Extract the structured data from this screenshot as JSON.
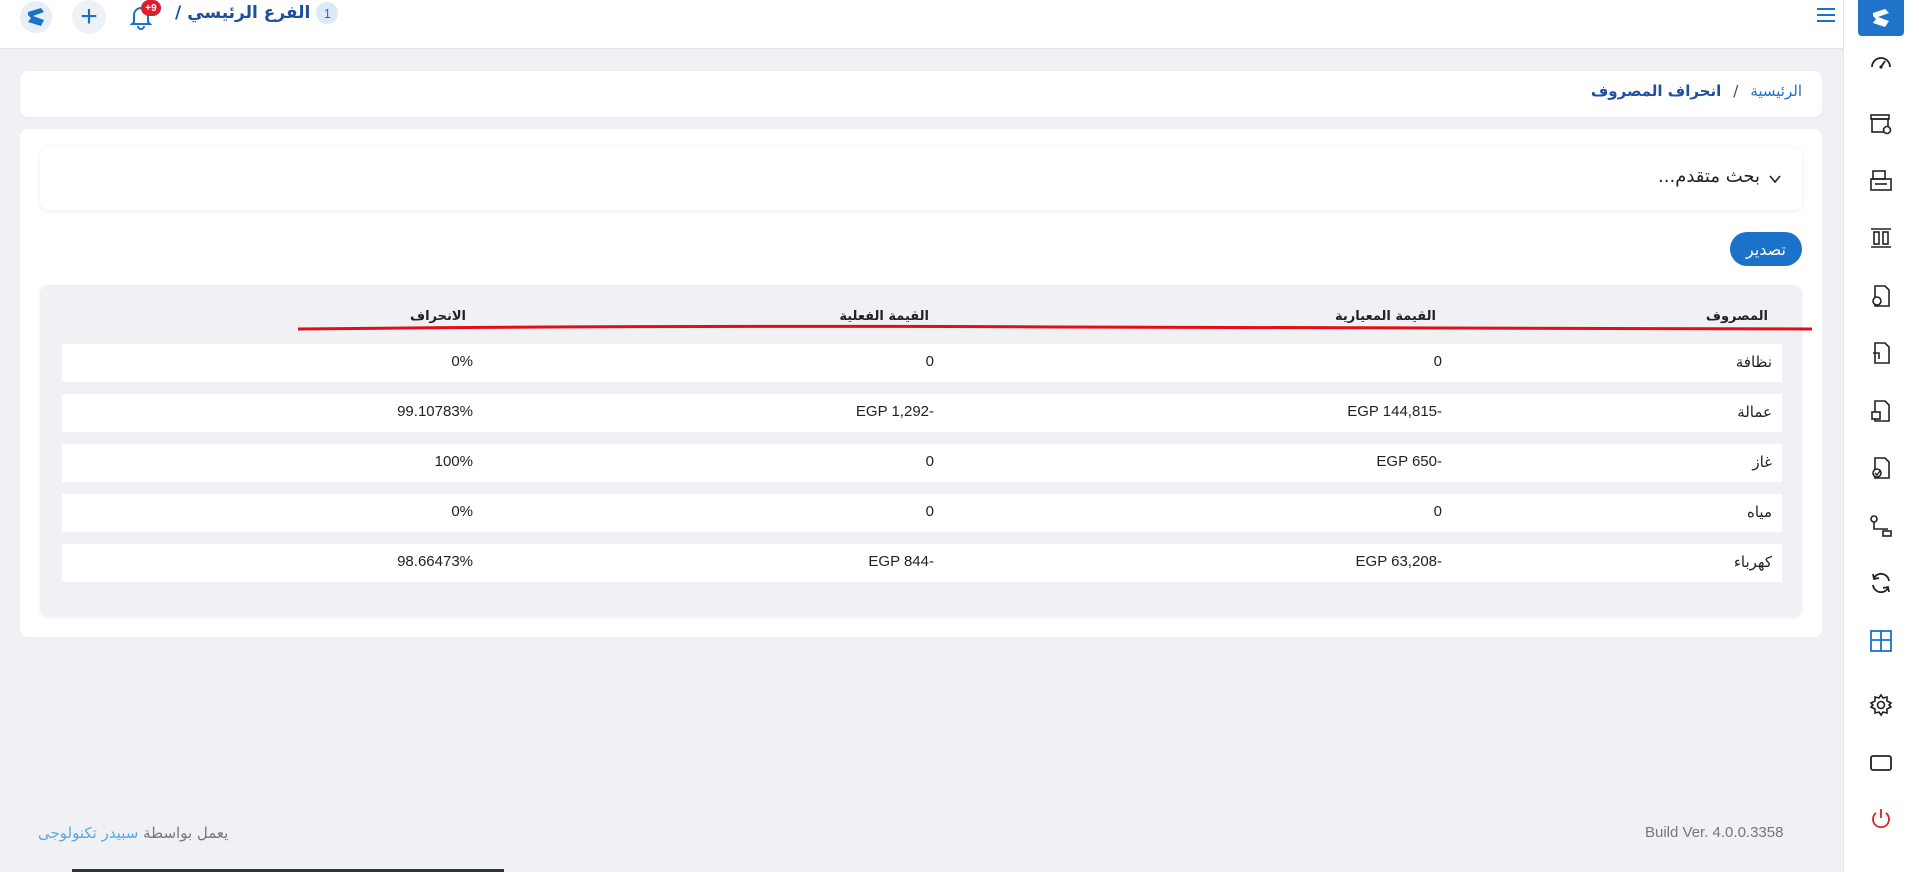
{
  "topbar": {
    "notifications_badge": "+9",
    "branch_count": "1",
    "branch_name": "الفرع الرئيسي",
    "branch_slash": "/"
  },
  "breadcrumb": {
    "home": "الرئيسية",
    "separator": "/",
    "current": "انحراف المصروف"
  },
  "search": {
    "label": "بحث متقدم..."
  },
  "actions": {
    "export_label": "تصدير"
  },
  "table": {
    "columns": [
      "المصروف",
      "القيمة المعيارية",
      "القيمة الفعلية",
      "الانحراف"
    ],
    "rows": [
      {
        "expense": "نظافة",
        "standard": "0",
        "actual": "0",
        "deviation": "0%"
      },
      {
        "expense": "عمالة",
        "standard": "EGP 144,815-",
        "actual": "EGP 1,292-",
        "deviation": "99.10783%"
      },
      {
        "expense": "غاز",
        "standard": "EGP 650-",
        "actual": "0",
        "deviation": "100%"
      },
      {
        "expense": "مياه",
        "standard": "0",
        "actual": "0",
        "deviation": "0%"
      },
      {
        "expense": "كهرباء",
        "standard": "EGP 63,208-",
        "actual": "EGP 844-",
        "deviation": "98.66473%"
      }
    ]
  },
  "footer": {
    "powered_prefix": "يعمل بواسطة",
    "powered_brand": "سبيدر تكنولوجى",
    "build": "Build Ver. 4.0.0.3358"
  },
  "colors": {
    "accent": "#1a73c8",
    "badge": "#d8202e",
    "annotation_line": "#e0101a"
  },
  "sidebar_icons": [
    "dashboard-icon",
    "store-settings-icon",
    "cashier-icon",
    "columns-icon",
    "money-document-icon",
    "document-icon",
    "package-document-icon",
    "check-document-icon",
    "transfer-icon",
    "refresh-icon",
    "layout-icon",
    "settings-icon",
    "screen-icon",
    "power-icon"
  ]
}
